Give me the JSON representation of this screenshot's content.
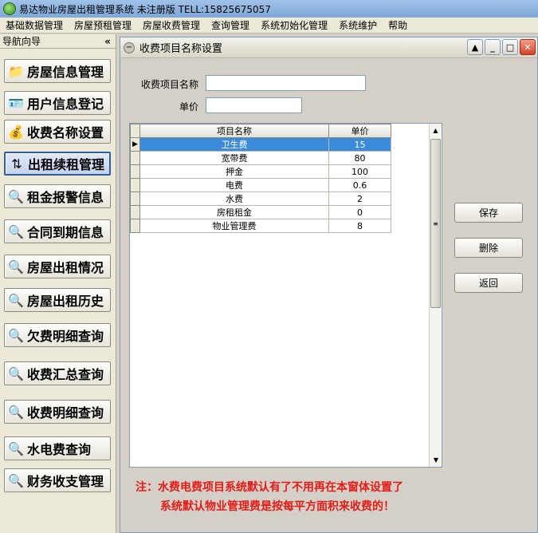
{
  "titlebar": {
    "title": "易达物业房屋出租管理系统 未注册版 TELL:15825675057"
  },
  "menu": [
    "基础数据管理",
    "房屋预租管理",
    "房屋收费管理",
    "查询管理",
    "系统初始化管理",
    "系统维护",
    "帮助"
  ],
  "sidebar": {
    "header": "导航向导",
    "collapse": "«",
    "items": [
      {
        "label": "房屋信息管理",
        "icon": "folder-pencil-icon"
      },
      {
        "label": "用户信息登记",
        "icon": "user-card-icon"
      },
      {
        "label": "收费名称设置",
        "icon": "money-bag-icon"
      },
      {
        "label": "出租续租管理",
        "icon": "transfer-arrows-icon"
      },
      {
        "label": "租金报警信息",
        "icon": "magnifier-icon"
      },
      {
        "label": "合同到期信息",
        "icon": "magnifier-icon"
      },
      {
        "label": "房屋出租情况",
        "icon": "magnifier-icon"
      },
      {
        "label": "房屋出租历史",
        "icon": "magnifier-icon"
      },
      {
        "label": "欠费明细查询",
        "icon": "magnifier-icon"
      },
      {
        "label": "收费汇总查询",
        "icon": "magnifier-icon"
      },
      {
        "label": "收费明细查询",
        "icon": "magnifier-icon"
      },
      {
        "label": "水电费查询",
        "icon": "magnifier-icon"
      },
      {
        "label": "财务收支管理",
        "icon": "magnifier-icon"
      }
    ]
  },
  "window": {
    "title": "收费项目名称设置",
    "name_label": "收费项目名称",
    "name_value": "",
    "price_label": "单价",
    "price_value": "",
    "columns": [
      "项目名称",
      "单价"
    ],
    "rows": [
      {
        "name": "卫生费",
        "price": "15",
        "selected": true
      },
      {
        "name": "宽带费",
        "price": "80"
      },
      {
        "name": "押金",
        "price": "100"
      },
      {
        "name": "电费",
        "price": "0.6"
      },
      {
        "name": "水费",
        "price": "2"
      },
      {
        "name": "房租租金",
        "price": "0"
      },
      {
        "name": "物业管理费",
        "price": "8"
      }
    ],
    "buttons": {
      "save": "保存",
      "delete": "删除",
      "back": "返回"
    },
    "note_line1": "注：水费电费项目系统默认有了不用再在本窗体设置了",
    "note_line2": "系统默认物业管理费是按每平方面积来收费的！"
  },
  "colors": {
    "selection": "#3a8bd9",
    "note": "#e41b17"
  }
}
